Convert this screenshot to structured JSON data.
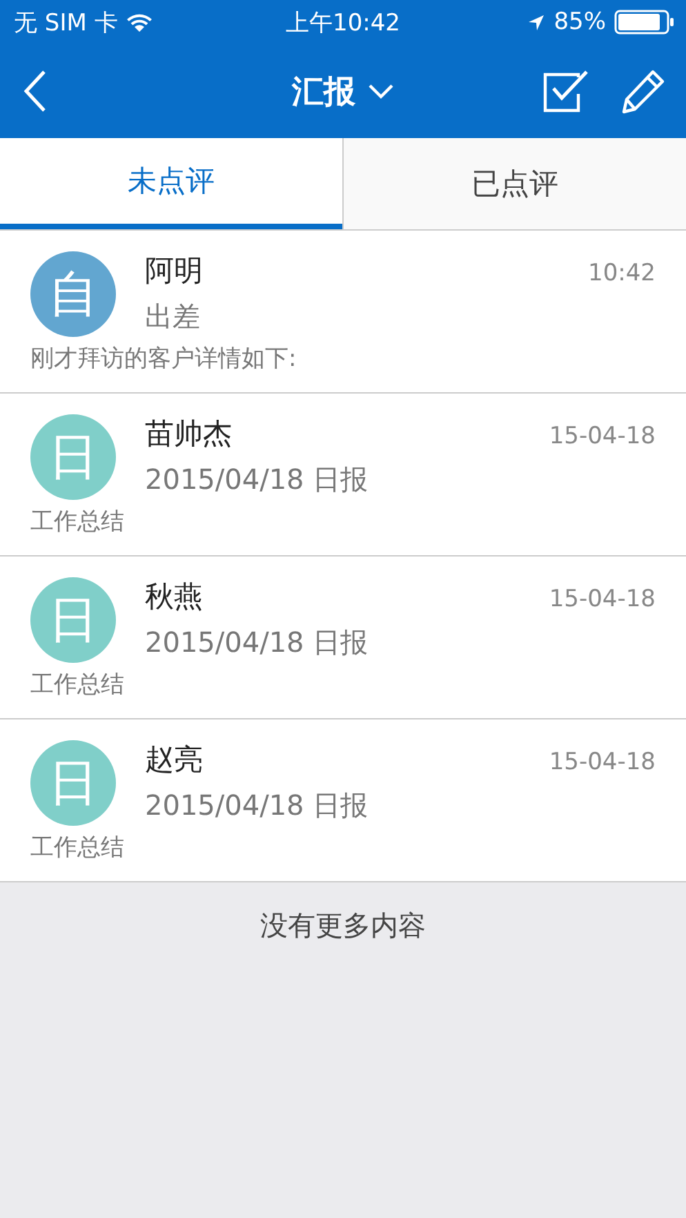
{
  "status_bar": {
    "carrier": "无 SIM 卡",
    "time": "上午10:42",
    "battery": "85%"
  },
  "nav": {
    "title": "汇报"
  },
  "tabs": [
    {
      "label": "未点评",
      "selected": true
    },
    {
      "label": "已点评",
      "selected": false
    }
  ],
  "reports": [
    {
      "avatar": "自",
      "color": "#62a6d0",
      "name": "阿明",
      "time": "10:42",
      "subtitle": "出差",
      "preview": "刚才拜访的客户详情如下:"
    },
    {
      "avatar": "日",
      "color": "#80cfc9",
      "name": "苗帅杰",
      "time": "15-04-18",
      "subtitle": "2015/04/18 日报",
      "preview": "工作总结"
    },
    {
      "avatar": "日",
      "color": "#80cfc9",
      "name": "秋燕",
      "time": "15-04-18",
      "subtitle": "2015/04/18 日报",
      "preview": "工作总结"
    },
    {
      "avatar": "日",
      "color": "#80cfc9",
      "name": "赵亮",
      "time": "15-04-18",
      "subtitle": "2015/04/18 日报",
      "preview": "工作总结"
    }
  ],
  "footer": "没有更多内容"
}
